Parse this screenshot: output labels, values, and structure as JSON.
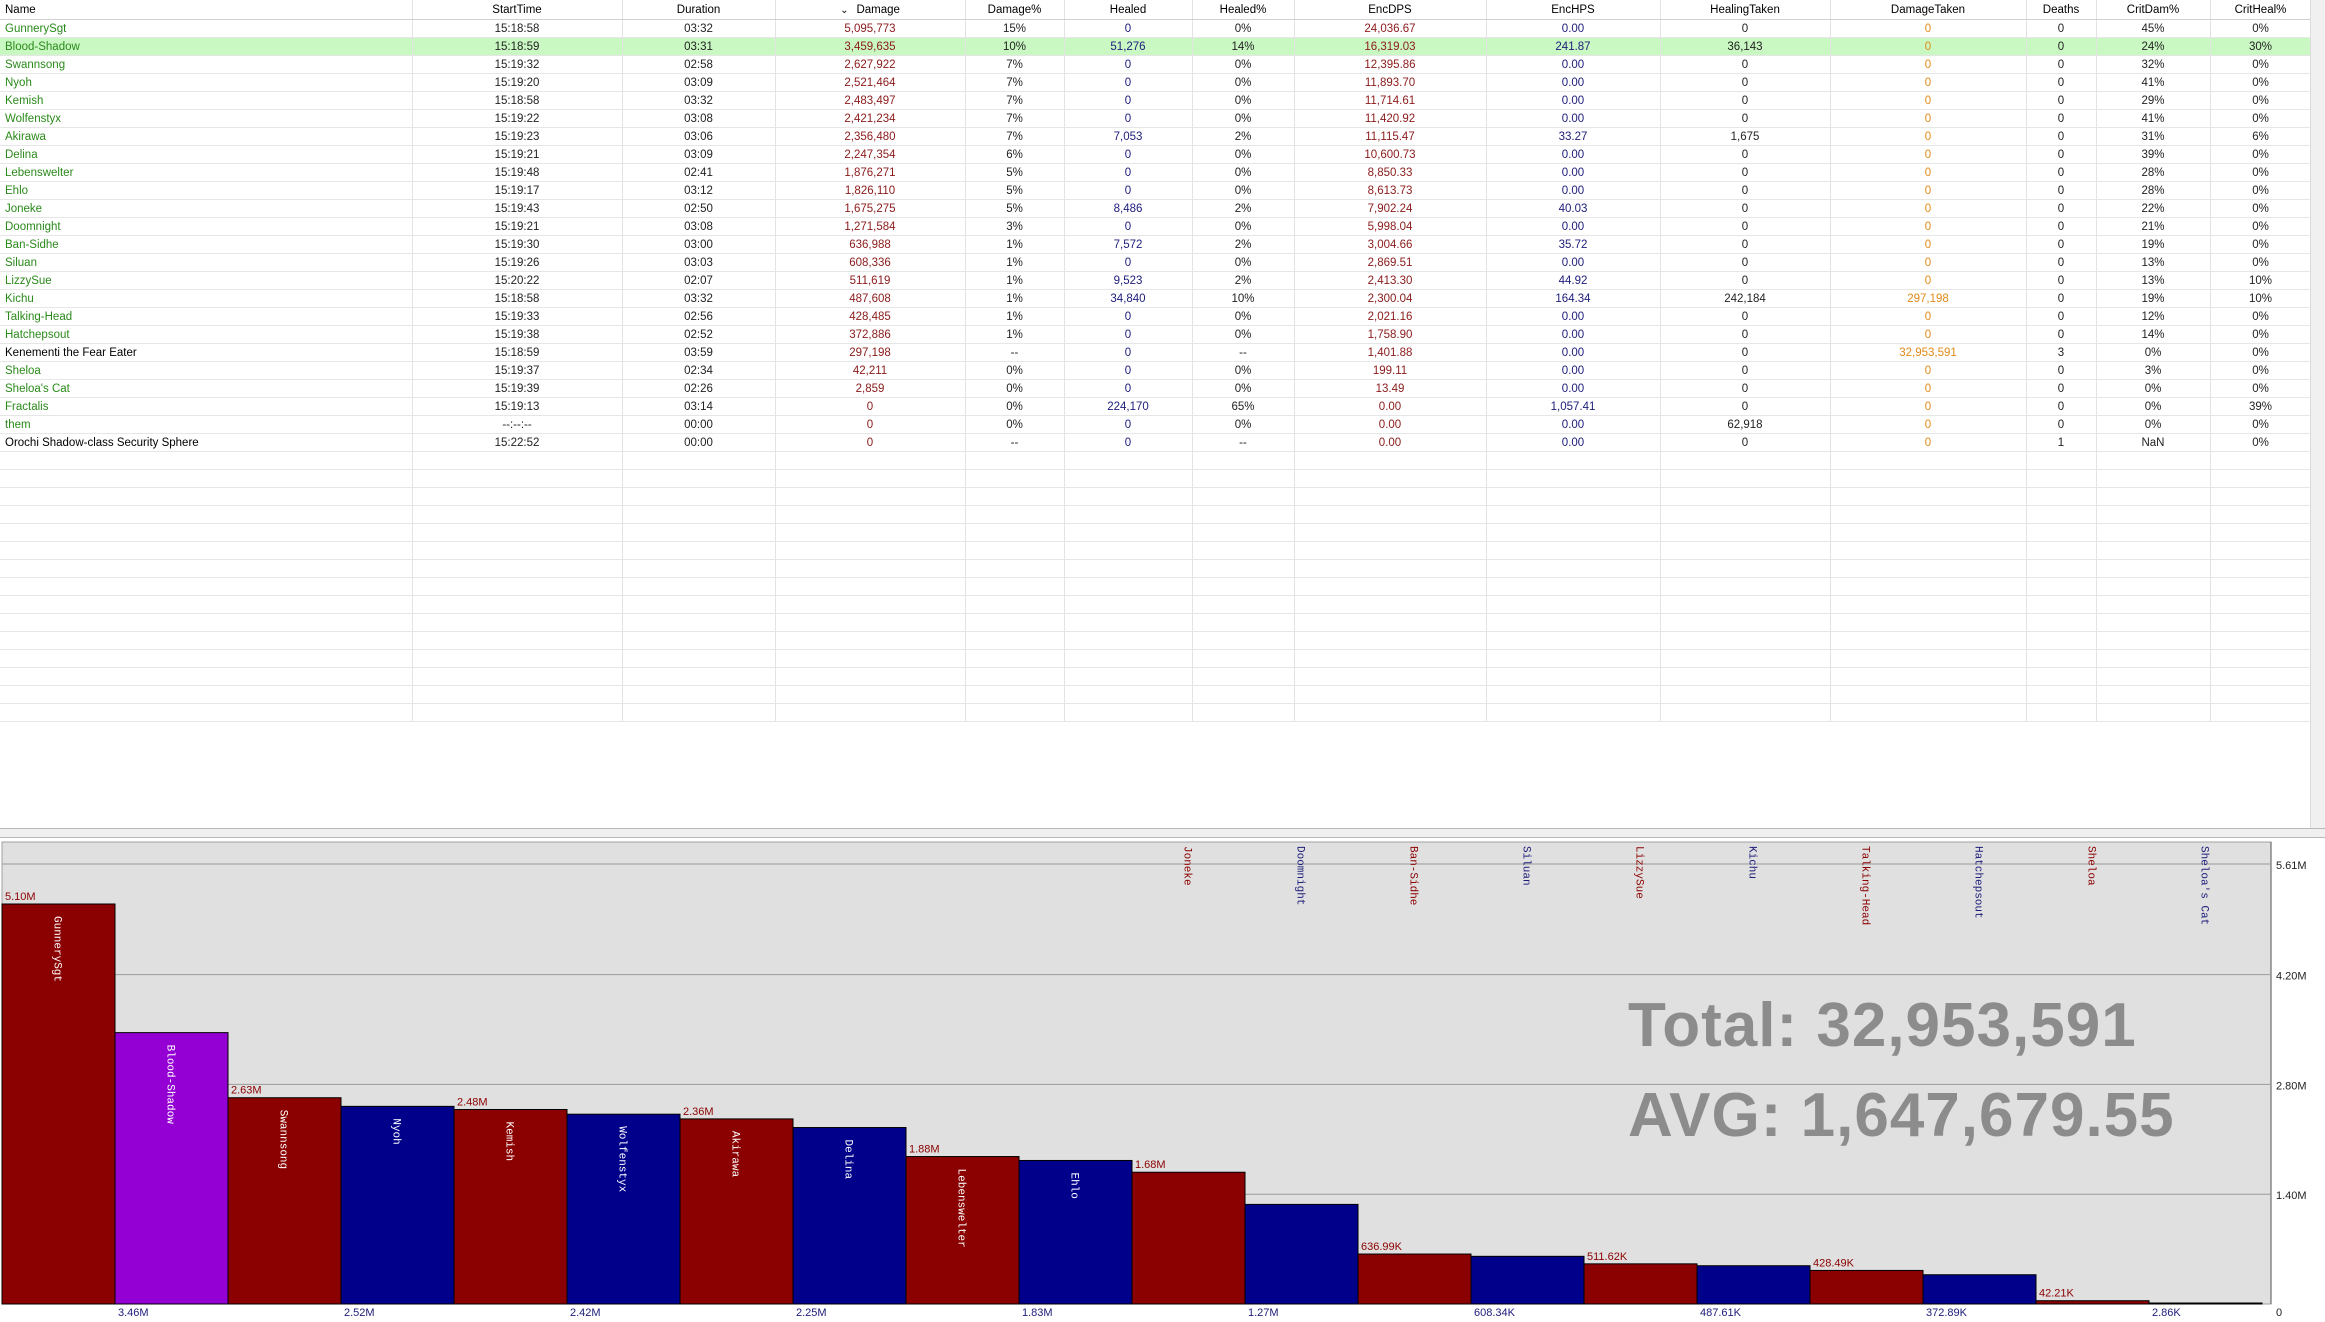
{
  "columns": [
    "Name",
    "StartTime",
    "Duration",
    "Damage",
    "Damage%",
    "Healed",
    "Healed%",
    "EncDPS",
    "EncHPS",
    "HealingTaken",
    "DamageTaken",
    "Deaths",
    "CritDam%",
    "CritHeal%"
  ],
  "sort_indicator": "⌄",
  "sort_column": "Damage",
  "rows": [
    {
      "name": "GunnerySgt",
      "color": "#2a8a1a",
      "start": "15:18:58",
      "duration": "03:32",
      "damage": "5,095,773",
      "damage_pct": "15%",
      "healed": "0",
      "healed_pct": "0%",
      "encdps": "24,036.67",
      "enchps": "0.00",
      "healing_taken": "0",
      "damage_taken": "0",
      "deaths": "0",
      "critdam": "45%",
      "critheal": "0%"
    },
    {
      "name": "Blood-Shadow",
      "color": "#2a8a1a",
      "selected": true,
      "start": "15:18:59",
      "duration": "03:31",
      "damage": "3,459,635",
      "damage_pct": "10%",
      "healed": "51,276",
      "healed_pct": "14%",
      "encdps": "16,319.03",
      "enchps": "241.87",
      "healing_taken": "36,143",
      "damage_taken": "0",
      "deaths": "0",
      "critdam": "24%",
      "critheal": "30%"
    },
    {
      "name": "Swannsong",
      "color": "#2a8a1a",
      "start": "15:19:32",
      "duration": "02:58",
      "damage": "2,627,922",
      "damage_pct": "7%",
      "healed": "0",
      "healed_pct": "0%",
      "encdps": "12,395.86",
      "enchps": "0.00",
      "healing_taken": "0",
      "damage_taken": "0",
      "deaths": "0",
      "critdam": "32%",
      "critheal": "0%"
    },
    {
      "name": "Nyoh",
      "color": "#2a8a1a",
      "start": "15:19:20",
      "duration": "03:09",
      "damage": "2,521,464",
      "damage_pct": "7%",
      "healed": "0",
      "healed_pct": "0%",
      "encdps": "11,893.70",
      "enchps": "0.00",
      "healing_taken": "0",
      "damage_taken": "0",
      "deaths": "0",
      "critdam": "41%",
      "critheal": "0%"
    },
    {
      "name": "Kemish",
      "color": "#2a8a1a",
      "start": "15:18:58",
      "duration": "03:32",
      "damage": "2,483,497",
      "damage_pct": "7%",
      "healed": "0",
      "healed_pct": "0%",
      "encdps": "11,714.61",
      "enchps": "0.00",
      "healing_taken": "0",
      "damage_taken": "0",
      "deaths": "0",
      "critdam": "29%",
      "critheal": "0%"
    },
    {
      "name": "Wolfenstyx",
      "color": "#2a8a1a",
      "start": "15:19:22",
      "duration": "03:08",
      "damage": "2,421,234",
      "damage_pct": "7%",
      "healed": "0",
      "healed_pct": "0%",
      "encdps": "11,420.92",
      "enchps": "0.00",
      "healing_taken": "0",
      "damage_taken": "0",
      "deaths": "0",
      "critdam": "41%",
      "critheal": "0%"
    },
    {
      "name": "Akirawa",
      "color": "#2a8a1a",
      "start": "15:19:23",
      "duration": "03:06",
      "damage": "2,356,480",
      "damage_pct": "7%",
      "healed": "7,053",
      "healed_pct": "2%",
      "encdps": "11,115.47",
      "enchps": "33.27",
      "healing_taken": "1,675",
      "damage_taken": "0",
      "deaths": "0",
      "critdam": "31%",
      "critheal": "6%"
    },
    {
      "name": "Delina",
      "color": "#2a8a1a",
      "start": "15:19:21",
      "duration": "03:09",
      "damage": "2,247,354",
      "damage_pct": "6%",
      "healed": "0",
      "healed_pct": "0%",
      "encdps": "10,600.73",
      "enchps": "0.00",
      "healing_taken": "0",
      "damage_taken": "0",
      "deaths": "0",
      "critdam": "39%",
      "critheal": "0%"
    },
    {
      "name": "Lebenswelter",
      "color": "#2a8a1a",
      "start": "15:19:48",
      "duration": "02:41",
      "damage": "1,876,271",
      "damage_pct": "5%",
      "healed": "0",
      "healed_pct": "0%",
      "encdps": "8,850.33",
      "enchps": "0.00",
      "healing_taken": "0",
      "damage_taken": "0",
      "deaths": "0",
      "critdam": "28%",
      "critheal": "0%"
    },
    {
      "name": "Ehlo",
      "color": "#2a8a1a",
      "start": "15:19:17",
      "duration": "03:12",
      "damage": "1,826,110",
      "damage_pct": "5%",
      "healed": "0",
      "healed_pct": "0%",
      "encdps": "8,613.73",
      "enchps": "0.00",
      "healing_taken": "0",
      "damage_taken": "0",
      "deaths": "0",
      "critdam": "28%",
      "critheal": "0%"
    },
    {
      "name": "Joneke",
      "color": "#2a8a1a",
      "start": "15:19:43",
      "duration": "02:50",
      "damage": "1,675,275",
      "damage_pct": "5%",
      "healed": "8,486",
      "healed_pct": "2%",
      "encdps": "7,902.24",
      "enchps": "40.03",
      "healing_taken": "0",
      "damage_taken": "0",
      "deaths": "0",
      "critdam": "22%",
      "critheal": "0%"
    },
    {
      "name": "Doomnight",
      "color": "#2a8a1a",
      "start": "15:19:21",
      "duration": "03:08",
      "damage": "1,271,584",
      "damage_pct": "3%",
      "healed": "0",
      "healed_pct": "0%",
      "encdps": "5,998.04",
      "enchps": "0.00",
      "healing_taken": "0",
      "damage_taken": "0",
      "deaths": "0",
      "critdam": "21%",
      "critheal": "0%"
    },
    {
      "name": "Ban-Sidhe",
      "color": "#2a8a1a",
      "start": "15:19:30",
      "duration": "03:00",
      "damage": "636,988",
      "damage_pct": "1%",
      "healed": "7,572",
      "healed_pct": "2%",
      "encdps": "3,004.66",
      "enchps": "35.72",
      "healing_taken": "0",
      "damage_taken": "0",
      "deaths": "0",
      "critdam": "19%",
      "critheal": "0%"
    },
    {
      "name": "Siluan",
      "color": "#2a8a1a",
      "start": "15:19:26",
      "duration": "03:03",
      "damage": "608,336",
      "damage_pct": "1%",
      "healed": "0",
      "healed_pct": "0%",
      "encdps": "2,869.51",
      "enchps": "0.00",
      "healing_taken": "0",
      "damage_taken": "0",
      "deaths": "0",
      "critdam": "13%",
      "critheal": "0%"
    },
    {
      "name": "LizzySue",
      "color": "#2a8a1a",
      "start": "15:20:22",
      "duration": "02:07",
      "damage": "511,619",
      "damage_pct": "1%",
      "healed": "9,523",
      "healed_pct": "2%",
      "encdps": "2,413.30",
      "enchps": "44.92",
      "healing_taken": "0",
      "damage_taken": "0",
      "deaths": "0",
      "critdam": "13%",
      "critheal": "10%"
    },
    {
      "name": "Kichu",
      "color": "#2a8a1a",
      "start": "15:18:58",
      "duration": "03:32",
      "damage": "487,608",
      "damage_pct": "1%",
      "healed": "34,840",
      "healed_pct": "10%",
      "encdps": "2,300.04",
      "enchps": "164.34",
      "healing_taken": "242,184",
      "damage_taken": "297,198",
      "deaths": "0",
      "critdam": "19%",
      "critheal": "10%"
    },
    {
      "name": "Talking-Head",
      "color": "#2a8a1a",
      "start": "15:19:33",
      "duration": "02:56",
      "damage": "428,485",
      "damage_pct": "1%",
      "healed": "0",
      "healed_pct": "0%",
      "encdps": "2,021.16",
      "enchps": "0.00",
      "healing_taken": "0",
      "damage_taken": "0",
      "deaths": "0",
      "critdam": "12%",
      "critheal": "0%"
    },
    {
      "name": "Hatchepsout",
      "color": "#2a8a1a",
      "start": "15:19:38",
      "duration": "02:52",
      "damage": "372,886",
      "damage_pct": "1%",
      "healed": "0",
      "healed_pct": "0%",
      "encdps": "1,758.90",
      "enchps": "0.00",
      "healing_taken": "0",
      "damage_taken": "0",
      "deaths": "0",
      "critdam": "14%",
      "critheal": "0%"
    },
    {
      "name": "Kenementi the Fear Eater",
      "color": "#000000",
      "start": "15:18:59",
      "duration": "03:59",
      "damage": "297,198",
      "damage_pct": "--",
      "healed": "0",
      "healed_pct": "--",
      "encdps": "1,401.88",
      "enchps": "0.00",
      "healing_taken": "0",
      "damage_taken": "32,953,591",
      "deaths": "3",
      "critdam": "0%",
      "critheal": "0%"
    },
    {
      "name": "Sheloa",
      "color": "#2a8a1a",
      "start": "15:19:37",
      "duration": "02:34",
      "damage": "42,211",
      "damage_pct": "0%",
      "healed": "0",
      "healed_pct": "0%",
      "encdps": "199.11",
      "enchps": "0.00",
      "healing_taken": "0",
      "damage_taken": "0",
      "deaths": "0",
      "critdam": "3%",
      "critheal": "0%"
    },
    {
      "name": "Sheloa's Cat",
      "color": "#2a8a1a",
      "start": "15:19:39",
      "duration": "02:26",
      "damage": "2,859",
      "damage_pct": "0%",
      "healed": "0",
      "healed_pct": "0%",
      "encdps": "13.49",
      "enchps": "0.00",
      "healing_taken": "0",
      "damage_taken": "0",
      "deaths": "0",
      "critdam": "0%",
      "critheal": "0%"
    },
    {
      "name": "Fractalis",
      "color": "#2a8a1a",
      "start": "15:19:13",
      "duration": "03:14",
      "damage": "0",
      "damage_pct": "0%",
      "healed": "224,170",
      "healed_pct": "65%",
      "encdps": "0.00",
      "enchps": "1,057.41",
      "healing_taken": "0",
      "damage_taken": "0",
      "deaths": "0",
      "critdam": "0%",
      "critheal": "39%"
    },
    {
      "name": "them",
      "color": "#2a8a1a",
      "start": "--:--:--",
      "duration": "00:00",
      "damage": "0",
      "damage_pct": "0%",
      "healed": "0",
      "healed_pct": "0%",
      "encdps": "0.00",
      "enchps": "0.00",
      "healing_taken": "62,918",
      "damage_taken": "0",
      "deaths": "0",
      "critdam": "0%",
      "critheal": "0%"
    },
    {
      "name": "Orochi Shadow-class Security Sphere",
      "color": "#000000",
      "start": "15:22:52",
      "duration": "00:00",
      "damage": "0",
      "damage_pct": "--",
      "healed": "0",
      "healed_pct": "--",
      "encdps": "0.00",
      "enchps": "0.00",
      "healing_taken": "0",
      "damage_taken": "0",
      "deaths": "1",
      "critdam": "NaN",
      "critheal": "0%"
    }
  ],
  "overlay": {
    "total_text": "Total: 32,953,591",
    "avg_text": "AVG: 1,647,679.55"
  },
  "colors": {
    "bar_red": "#8b0000",
    "bar_blue": "#00008b",
    "bar_highlight": "#9400d3",
    "chart_bg": "#e0e0e0",
    "selected_row": "#c9f8c2",
    "damage_text": "#8b1a1a",
    "heal_text": "#1c1c7a",
    "damage_taken_text": "#e08a18"
  },
  "chart_data": {
    "type": "bar",
    "ylim": [
      0,
      5.61
    ],
    "y_unit": "M",
    "y_ticks": [
      {
        "value": 5.61,
        "label": "5.61M"
      },
      {
        "value": 4.2,
        "label": "4.20M"
      },
      {
        "value": 2.8,
        "label": "2.80M"
      },
      {
        "value": 1.4,
        "label": "1.40M"
      },
      {
        "value": 0,
        "label": "0"
      }
    ],
    "bars": [
      {
        "name": "GunnerySgt",
        "value": 5.1,
        "label": "5.10M",
        "color": "#8b0000",
        "label_pos": "top"
      },
      {
        "name": "Blood-Shadow",
        "value": 3.46,
        "label": "3.46M",
        "color": "#9400d3",
        "label_pos": "bottom"
      },
      {
        "name": "Swannsong",
        "value": 2.63,
        "label": "2.63M",
        "color": "#8b0000",
        "label_pos": "top"
      },
      {
        "name": "Nyoh",
        "value": 2.52,
        "label": "2.52M",
        "color": "#00008b",
        "label_pos": "bottom"
      },
      {
        "name": "Kemish",
        "value": 2.48,
        "label": "2.48M",
        "color": "#8b0000",
        "label_pos": "top"
      },
      {
        "name": "Wolfenstyx",
        "value": 2.42,
        "label": "2.42M",
        "color": "#00008b",
        "label_pos": "bottom"
      },
      {
        "name": "Akirawa",
        "value": 2.36,
        "label": "2.36M",
        "color": "#8b0000",
        "label_pos": "top"
      },
      {
        "name": "Delina",
        "value": 2.25,
        "label": "2.25M",
        "color": "#00008b",
        "label_pos": "bottom"
      },
      {
        "name": "Lebenswelter",
        "value": 1.88,
        "label": "1.88M",
        "color": "#8b0000",
        "label_pos": "top"
      },
      {
        "name": "Ehlo",
        "value": 1.83,
        "label": "1.83M",
        "color": "#00008b",
        "label_pos": "bottom"
      },
      {
        "name": "Joneke",
        "value": 1.68,
        "label": "1.68M",
        "color": "#8b0000",
        "label_pos": "top"
      },
      {
        "name": "Doomnight",
        "value": 1.27,
        "label": "1.27M",
        "color": "#00008b",
        "label_pos": "bottom"
      },
      {
        "name": "Ban-Sidhe",
        "value": 0.637,
        "label": "636.99K",
        "color": "#8b0000",
        "label_pos": "top"
      },
      {
        "name": "Siluan",
        "value": 0.608,
        "label": "608.34K",
        "color": "#00008b",
        "label_pos": "bottom"
      },
      {
        "name": "LizzySue",
        "value": 0.512,
        "label": "511.62K",
        "color": "#8b0000",
        "label_pos": "top"
      },
      {
        "name": "Kichu",
        "value": 0.488,
        "label": "487.61K",
        "color": "#00008b",
        "label_pos": "bottom"
      },
      {
        "name": "Talking-Head",
        "value": 0.428,
        "label": "428.49K",
        "color": "#8b0000",
        "label_pos": "top"
      },
      {
        "name": "Hatchepsout",
        "value": 0.373,
        "label": "372.89K",
        "color": "#00008b",
        "label_pos": "bottom"
      },
      {
        "name": "Sheloa",
        "value": 0.042,
        "label": "42.21K",
        "color": "#8b0000",
        "label_pos": "top"
      },
      {
        "name": "Sheloa's Cat",
        "value": 0.003,
        "label": "2.86K",
        "color": "#00008b",
        "label_pos": "bottom"
      }
    ],
    "grid": true
  }
}
